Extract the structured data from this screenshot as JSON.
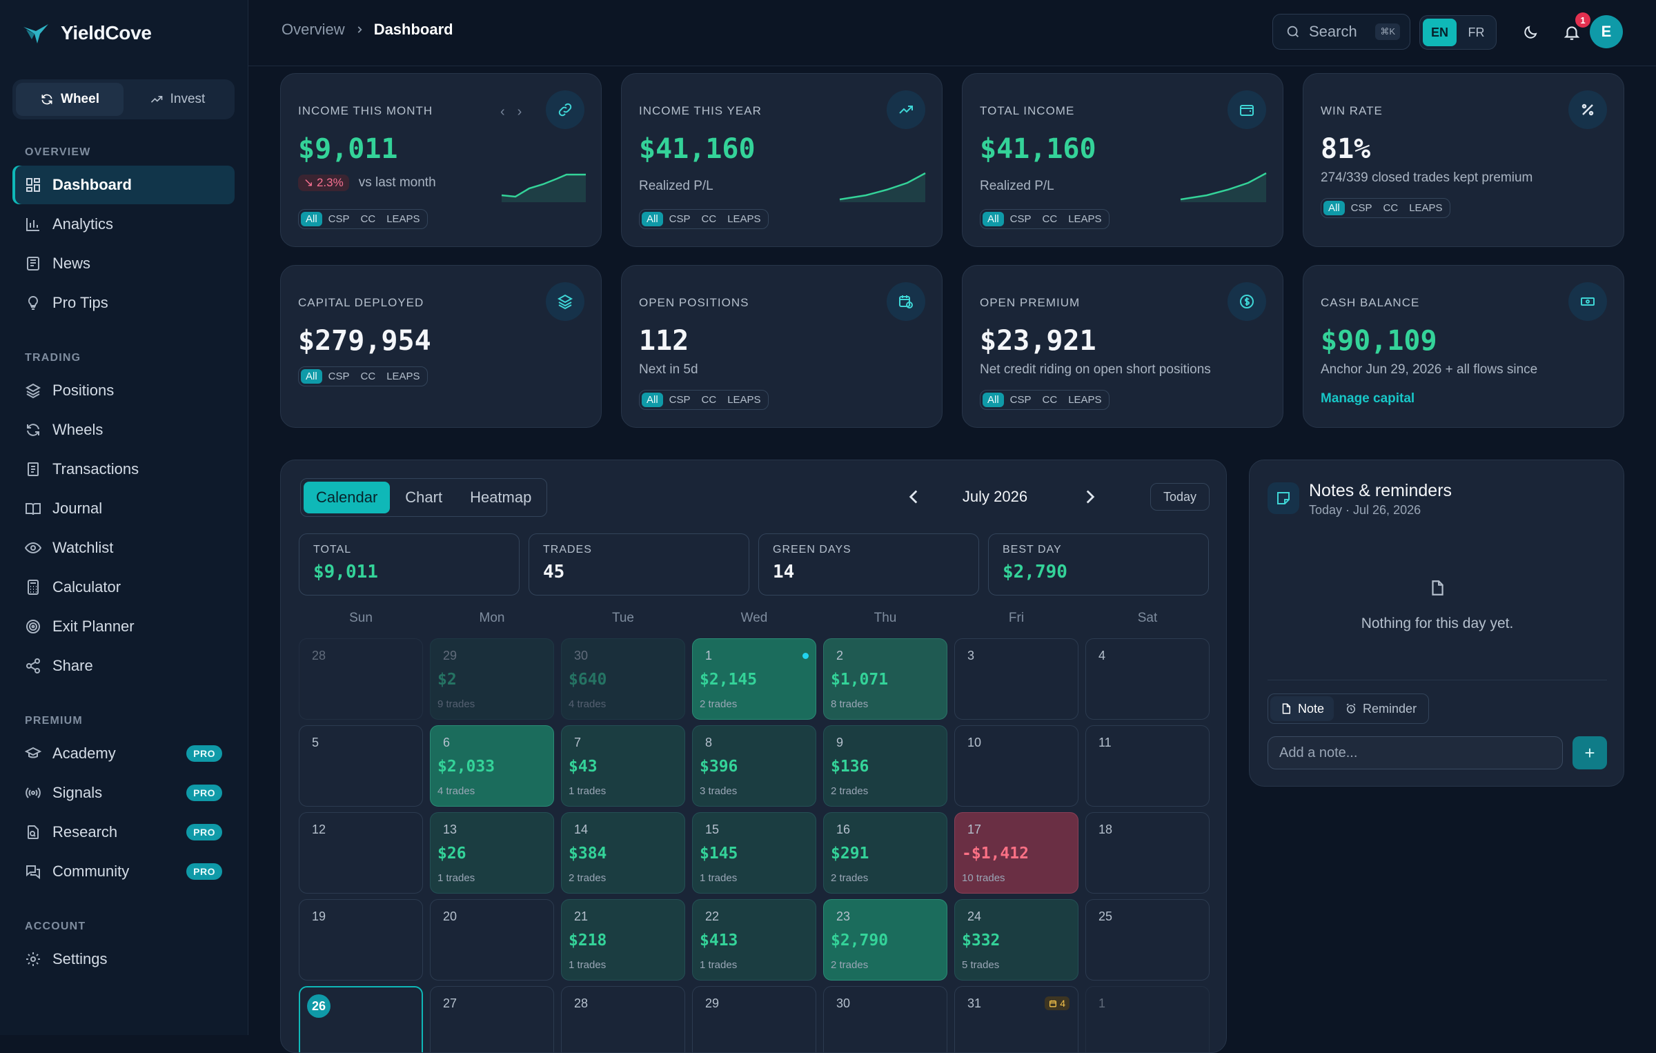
{
  "app": {
    "name": "YieldCove"
  },
  "mode": {
    "wheel": "Wheel",
    "invest": "Invest"
  },
  "nav": {
    "overview_title": "OVERVIEW",
    "trading_title": "TRADING",
    "premium_title": "PREMIUM",
    "account_title": "ACCOUNT",
    "pro_label": "PRO",
    "items": {
      "dashboard": "Dashboard",
      "analytics": "Analytics",
      "news": "News",
      "protips": "Pro Tips",
      "positions": "Positions",
      "wheels": "Wheels",
      "transactions": "Transactions",
      "journal": "Journal",
      "watchlist": "Watchlist",
      "calculator": "Calculator",
      "exitplanner": "Exit Planner",
      "share": "Share",
      "academy": "Academy",
      "signals": "Signals",
      "research": "Research",
      "community": "Community",
      "settings": "Settings"
    }
  },
  "topbar": {
    "breadcrumb": [
      "Overview",
      "Dashboard"
    ],
    "search_label": "Search",
    "search_shortcut": "⌘K",
    "lang": [
      "EN",
      "FR"
    ],
    "notif_count": "1",
    "avatar_initial": "E"
  },
  "filters": [
    "All",
    "CSP",
    "CC",
    "LEAPS"
  ],
  "cards": {
    "income_month": {
      "label": "INCOME THIS MONTH",
      "value": "$9,011",
      "delta": "2.3%",
      "delta_text": "vs last month"
    },
    "income_year": {
      "label": "INCOME THIS YEAR",
      "value": "$41,160",
      "sub": "Realized P/L"
    },
    "total_income": {
      "label": "TOTAL INCOME",
      "value": "$41,160",
      "sub": "Realized P/L"
    },
    "win_rate": {
      "label": "WIN RATE",
      "value": "81%",
      "sub": "274/339 closed trades kept premium"
    },
    "capital": {
      "label": "CAPITAL DEPLOYED",
      "value": "$279,954"
    },
    "open_positions": {
      "label": "OPEN POSITIONS",
      "value": "112",
      "sub": "Next in 5d"
    },
    "open_premium": {
      "label": "OPEN PREMIUM",
      "value": "$23,921",
      "sub": "Net credit riding on open short positions"
    },
    "cash": {
      "label": "CASH BALANCE",
      "value": "$90,109",
      "sub": "Anchor Jun 29, 2026 + all flows since",
      "link": "Manage capital"
    }
  },
  "calendar": {
    "tabs": [
      "Calendar",
      "Chart",
      "Heatmap"
    ],
    "month": "July 2026",
    "today_label": "Today",
    "stats": [
      {
        "label": "TOTAL",
        "value": "$9,011"
      },
      {
        "label": "TRADES",
        "value": "45"
      },
      {
        "label": "GREEN DAYS",
        "value": "14"
      },
      {
        "label": "BEST DAY",
        "value": "$2,790"
      }
    ],
    "dow": [
      "Sun",
      "Mon",
      "Tue",
      "Wed",
      "Thu",
      "Fri",
      "Sat"
    ],
    "weeks": [
      [
        {
          "d": "28",
          "s": "out"
        },
        {
          "d": "29",
          "a": "$2",
          "t": "9 trades",
          "s": "out pos"
        },
        {
          "d": "30",
          "a": "$640",
          "t": "4 trades",
          "s": "out pos"
        },
        {
          "d": "1",
          "a": "$2,145",
          "t": "2 trades",
          "s": "big",
          "dot": true
        },
        {
          "d": "2",
          "a": "$1,071",
          "t": "8 trades",
          "s": "mid"
        },
        {
          "d": "3"
        },
        {
          "d": "4"
        }
      ],
      [
        {
          "d": "5"
        },
        {
          "d": "6",
          "a": "$2,033",
          "t": "4 trades",
          "s": "big"
        },
        {
          "d": "7",
          "a": "$43",
          "t": "1 trades",
          "s": "pos"
        },
        {
          "d": "8",
          "a": "$396",
          "t": "3 trades",
          "s": "pos"
        },
        {
          "d": "9",
          "a": "$136",
          "t": "2 trades",
          "s": "pos"
        },
        {
          "d": "10"
        },
        {
          "d": "11"
        }
      ],
      [
        {
          "d": "12"
        },
        {
          "d": "13",
          "a": "$26",
          "t": "1 trades",
          "s": "pos"
        },
        {
          "d": "14",
          "a": "$384",
          "t": "2 trades",
          "s": "pos"
        },
        {
          "d": "15",
          "a": "$145",
          "t": "1 trades",
          "s": "pos"
        },
        {
          "d": "16",
          "a": "$291",
          "t": "2 trades",
          "s": "pos"
        },
        {
          "d": "17",
          "a": "-$1,412",
          "t": "10 trades",
          "s": "neg"
        },
        {
          "d": "18"
        }
      ],
      [
        {
          "d": "19"
        },
        {
          "d": "20"
        },
        {
          "d": "21",
          "a": "$218",
          "t": "1 trades",
          "s": "pos"
        },
        {
          "d": "22",
          "a": "$413",
          "t": "1 trades",
          "s": "pos"
        },
        {
          "d": "23",
          "a": "$2,790",
          "t": "2 trades",
          "s": "big"
        },
        {
          "d": "24",
          "a": "$332",
          "t": "5 trades",
          "s": "pos"
        },
        {
          "d": "25"
        }
      ],
      [
        {
          "d": "26",
          "s": "today"
        },
        {
          "d": "27"
        },
        {
          "d": "28"
        },
        {
          "d": "29"
        },
        {
          "d": "30"
        },
        {
          "d": "31",
          "badge": "4"
        },
        {
          "d": "1",
          "s": "out"
        }
      ]
    ]
  },
  "notes": {
    "title": "Notes & reminders",
    "subtitle": "Today · Jul 26, 2026",
    "empty": "Nothing for this day yet.",
    "tab_note": "Note",
    "tab_reminder": "Reminder",
    "placeholder": "Add a note...",
    "add": "+"
  },
  "colors": {
    "accent": "#0fb8b8",
    "positive": "#34d399",
    "negative": "#fb7185",
    "background": "#0c1524"
  }
}
